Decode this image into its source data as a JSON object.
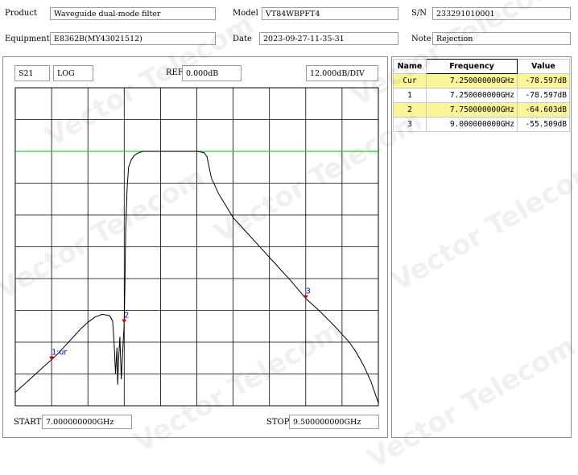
{
  "header": {
    "product_label": "Product",
    "product_value": "Waveguide dual-mode filter",
    "model_label": "Model",
    "model_value": "VT84WBPFT4",
    "sn_label": "S/N",
    "sn_value": "233291010001",
    "equipment_label": "Equipment",
    "equipment_value": "E8362B(MY43021512)",
    "date_label": "Date",
    "date_value": "2023-09-27-11-35-31",
    "note_label": "Note",
    "note_value": "Rejection"
  },
  "chart_header": {
    "param": "S21",
    "format": "LOG",
    "ref_label": "REF",
    "ref_value": "0.000dB",
    "scale": "12.000dB/DIV"
  },
  "chart_footer": {
    "start_label": "START",
    "start_value": "7.000000000GHz",
    "stop_label": "STOP",
    "stop_value": "9.500000000GHz"
  },
  "marker_table": {
    "headers": [
      "Name",
      "Frequency",
      "Value"
    ],
    "rows": [
      {
        "name": "Cur",
        "freq": "7.250000000GHz",
        "value": "-78.597dB",
        "highlight": true
      },
      {
        "name": "1",
        "freq": "7.250000000GHz",
        "value": "-78.597dB",
        "highlight": false
      },
      {
        "name": "2",
        "freq": "7.750000000GHz",
        "value": "-64.603dB",
        "highlight": true
      },
      {
        "name": "3",
        "freq": "9.000000000GHz",
        "value": "-55.509dB",
        "highlight": false
      }
    ]
  },
  "watermark": "Vector Telecom",
  "colors": {
    "trace": "#000000",
    "ref_line": "#33cc33",
    "grid": "#000000",
    "marker": "#cc0000",
    "marker_label": "#0000cc",
    "highlight": "#fbf59a"
  },
  "chart_data": {
    "type": "line",
    "x_unit": "GHz",
    "y_unit": "dB",
    "xlim": [
      7.0,
      9.5
    ],
    "ylim": [
      -96,
      24
    ],
    "ref_level": 0,
    "grid": true,
    "x_divisions": 10,
    "y_divisions": 10,
    "series": [
      {
        "x": [
          7.0,
          7.05,
          7.1,
          7.15,
          7.2,
          7.25,
          7.3,
          7.35,
          7.4,
          7.45,
          7.5,
          7.55,
          7.6,
          7.65,
          7.67,
          7.68,
          7.69,
          7.7,
          7.705,
          7.71,
          7.72,
          7.73,
          7.74,
          7.75,
          7.755,
          7.76,
          7.77,
          7.78,
          7.8,
          7.82,
          7.84,
          7.86,
          7.88,
          7.9,
          7.95,
          8.0,
          8.05,
          8.1,
          8.15,
          8.2,
          8.25,
          8.3,
          8.32,
          8.35,
          8.4,
          8.5,
          8.6,
          8.7,
          8.8,
          8.9,
          9.0,
          9.1,
          9.2,
          9.3,
          9.35,
          9.4,
          9.45,
          9.5
        ],
        "y": [
          -91,
          -88.5,
          -86,
          -83.5,
          -81,
          -78.6,
          -76,
          -73,
          -70,
          -67,
          -64.5,
          -62.5,
          -61.5,
          -62,
          -64,
          -72,
          -84,
          -74,
          -88,
          -80,
          -70,
          -86,
          -75,
          -64.6,
          -50,
          -30,
          -14,
          -6,
          -3,
          -1.5,
          -0.8,
          -0.3,
          0,
          0,
          0,
          0,
          0,
          0,
          0,
          0,
          0,
          -0.5,
          -2,
          -10,
          -16,
          -25,
          -31,
          -37,
          -43,
          -49,
          -55.5,
          -60.5,
          -66,
          -72,
          -76,
          -81,
          -87,
          -95
        ]
      }
    ],
    "markers": [
      {
        "label": "1:ur",
        "x": 7.25,
        "y": -78.597
      },
      {
        "label": "2",
        "x": 7.75,
        "y": -64.603
      },
      {
        "label": "3",
        "x": 9.0,
        "y": -55.509
      }
    ]
  }
}
